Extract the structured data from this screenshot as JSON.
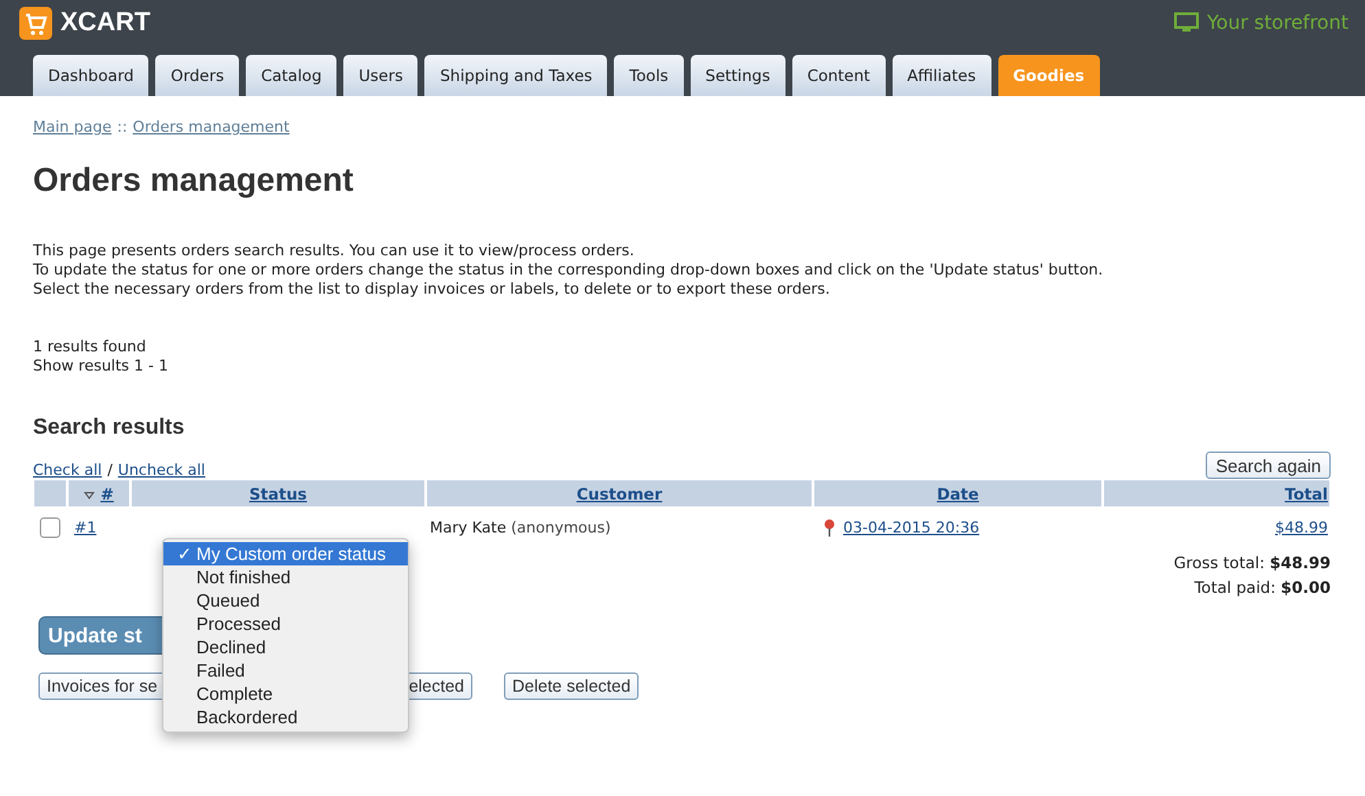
{
  "header": {
    "logo": "XCART",
    "storefront_link": "Your storefront"
  },
  "tabs": [
    {
      "label": "Dashboard",
      "kind": "normal"
    },
    {
      "label": "Orders",
      "kind": "normal"
    },
    {
      "label": "Catalog",
      "kind": "normal"
    },
    {
      "label": "Users",
      "kind": "normal"
    },
    {
      "label": "Shipping and Taxes",
      "kind": "normal"
    },
    {
      "label": "Tools",
      "kind": "normal"
    },
    {
      "label": "Settings",
      "kind": "normal"
    },
    {
      "label": "Content",
      "kind": "normal"
    },
    {
      "label": "Affiliates",
      "kind": "normal"
    },
    {
      "label": "Goodies",
      "kind": "highlight"
    }
  ],
  "breadcrumbs": {
    "items": [
      "Main page",
      "Orders management"
    ],
    "separator": "::"
  },
  "title": "Orders management",
  "description": [
    "This page presents orders search results. You can use it to view/process orders.",
    "To update the status for one or more orders change the status in the corresponding drop-down boxes and click on the 'Update status' button.",
    "Select the necessary orders from the list to display invoices or labels, to delete or to export these orders."
  ],
  "results": [
    "1 results found",
    "Show results 1 - 1"
  ],
  "section_title": "Search results",
  "check_all": "Check all",
  "check_separator": "/",
  "uncheck_all": "Uncheck all",
  "search_again": "Search again",
  "table": {
    "columns": [
      "#",
      "Status",
      "Customer",
      "Date",
      "Total"
    ],
    "rows": [
      {
        "checked": false,
        "number": "#1",
        "customer": "Mary Kate",
        "customer_note": "(anonymous)",
        "date": "03-04-2015 20:36",
        "total": "$48.99"
      }
    ]
  },
  "totals": [
    {
      "label": "Gross total:",
      "value": "$48.99"
    },
    {
      "label": "Total paid:",
      "value": "$0.00"
    }
  ],
  "update_button": "Update st",
  "action_buttons": [
    "Invoices for se",
    "elected",
    "Delete selected"
  ],
  "status_menu": [
    {
      "label": "My Custom order status",
      "selected": true
    },
    {
      "label": "Not finished",
      "selected": false
    },
    {
      "label": "Queued",
      "selected": false
    },
    {
      "label": "Processed",
      "selected": false
    },
    {
      "label": "Declined",
      "selected": false
    },
    {
      "label": "Failed",
      "selected": false
    },
    {
      "label": "Complete",
      "selected": false
    },
    {
      "label": "Backordered",
      "selected": false
    }
  ],
  "menu_check": "✓"
}
